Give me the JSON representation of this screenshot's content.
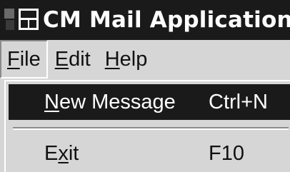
{
  "window": {
    "title": "CM Mail Application",
    "icon": "mail-app-icon"
  },
  "menubar": {
    "items": [
      {
        "label_underlined": "F",
        "label_rest": "ile",
        "active": true
      },
      {
        "label_underlined": "E",
        "label_rest": "dit",
        "active": false
      },
      {
        "label_underlined": "H",
        "label_rest": "elp",
        "active": false
      }
    ]
  },
  "file_menu": {
    "items": [
      {
        "label_underlined": "N",
        "label_rest": "ew Message",
        "shortcut": "Ctrl+N",
        "selected": true
      },
      {
        "label_pre": "E",
        "label_underlined": "x",
        "label_rest": "it",
        "shortcut": "F10",
        "selected": false
      }
    ]
  },
  "colors": {
    "titlebar_bg": "#1a1a1a",
    "face": "#d6d6d6",
    "highlight_bg": "#1a1a1a",
    "highlight_text": "#ffffff"
  }
}
